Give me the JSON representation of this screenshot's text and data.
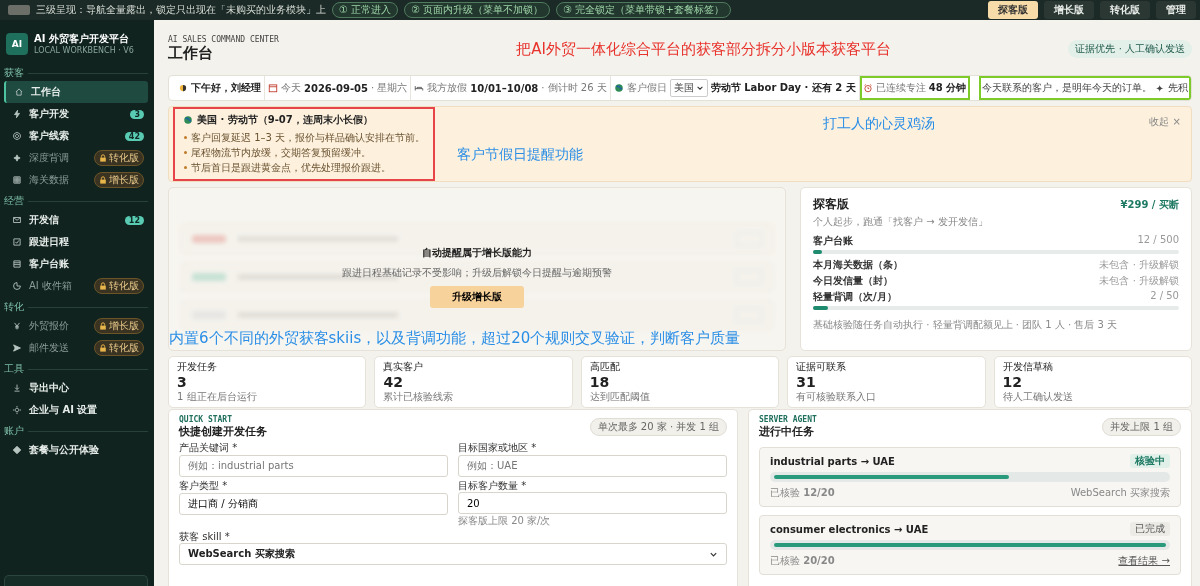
{
  "top_bar": {
    "caption": "三级呈现：导航全量露出，锁定只出现在「未购买的业务模块」上",
    "modes": [
      "① 正常进入",
      "② 页面内升级（菜单不加锁）",
      "③ 完全锁定（菜单带锁+套餐标签）"
    ],
    "plans": [
      {
        "label": "探客版",
        "selected": true
      },
      {
        "label": "增长版",
        "selected": false
      },
      {
        "label": "转化版",
        "selected": false
      },
      {
        "label": "管理",
        "selected": false
      }
    ]
  },
  "sidebar": {
    "logo": "AI",
    "title": "AI 外贸客户开发平台",
    "subtitle": "LOCAL WORKBENCH · V6",
    "sections": [
      {
        "label": "获客",
        "items": [
          {
            "label": "工作台",
            "selected": true,
            "kind": "plain"
          },
          {
            "label": "客户开发",
            "selected": false,
            "kind": "count",
            "badge": "3"
          },
          {
            "label": "客户线索",
            "selected": false,
            "kind": "count",
            "badge": "42"
          },
          {
            "label": "深度背调",
            "selected": false,
            "kind": "locked",
            "badge": "转化版"
          },
          {
            "label": "海关数据",
            "selected": false,
            "kind": "locked",
            "badge": "增长版"
          }
        ]
      },
      {
        "label": "经营",
        "items": [
          {
            "label": "开发信",
            "selected": false,
            "kind": "count",
            "badge": "12"
          },
          {
            "label": "跟进日程",
            "selected": false,
            "kind": "plain"
          },
          {
            "label": "客户台账",
            "selected": false,
            "kind": "plain"
          },
          {
            "label": "AI 收件箱",
            "selected": false,
            "kind": "locked",
            "badge": "转化版"
          }
        ]
      },
      {
        "label": "转化",
        "items": [
          {
            "label": "外贸报价",
            "selected": false,
            "kind": "locked",
            "badge": "增长版"
          },
          {
            "label": "邮件发送",
            "selected": false,
            "kind": "locked",
            "badge": "转化版"
          }
        ]
      },
      {
        "label": "工具",
        "items": [
          {
            "label": "导出中心",
            "selected": false,
            "kind": "plain"
          },
          {
            "label": "企业与 AI 设置",
            "selected": false,
            "kind": "plain"
          }
        ]
      },
      {
        "label": "账户",
        "items": [
          {
            "label": "套餐与公开体验",
            "selected": false,
            "kind": "plain"
          }
        ]
      }
    ]
  },
  "header": {
    "eyebrow": "AI SALES COMMAND CENTER",
    "title": "工作台",
    "note": "把AI外贸一体化综合平台的获客部分拆分小版本获客平台",
    "badge": "证据优先 · 人工确认发送"
  },
  "info_bar": {
    "greeting": "下午好，刘经理",
    "today_label": "今天",
    "today": "2026-09-05",
    "weekday": "· 星期六",
    "vacation_label": "我方放假",
    "vacation": "10/01–10/08",
    "countdown": "· 倒计时 26 天",
    "holiday_label": "客户假日",
    "country": "美国",
    "holiday": "劳动节 Labor Day · 还有 2 天",
    "focus": {
      "label": "已连续专注",
      "value": "48 分钟",
      "highlighted": true
    },
    "quote": {
      "text": "今天联系的客户，是明年今天的订单。",
      "mark": "✦",
      "next": "先积",
      "highlighted": true
    }
  },
  "holiday_banner": {
    "title": "美国 · 劳动节（9-07，连周末小长假）",
    "highlighted": true,
    "tips": [
      "客户回复延迟 1–3 天，报价与样品确认安排在节前。",
      "尾程物流节内放缓，交期答复预留缓冲。",
      "节后首日是跟进黄金点，优先处理报价跟进。"
    ],
    "notes": [
      "客户节假日提醒功能",
      "打工人的心灵鸡汤"
    ],
    "collapse": "收起 ×"
  },
  "locked_card": {
    "title": "自动提醒属于增长版能力",
    "text": "跟进日程基础记录不受影响；升级后解锁今日提醒与逾期预警",
    "button": "升级增长版",
    "note": "内置6个不同的外贸获客skiis，以及背调功能，超过20个规则交叉验证，判断客户质量"
  },
  "plan_card": {
    "title": "探客版",
    "price": "¥299 / 买断",
    "subtitle": "个人起步，跑通「找客户 → 发开发信」",
    "quotas": [
      {
        "kind": "meter",
        "label": "客户台账",
        "reading": "12 / 500",
        "level": 0.024
      },
      {
        "kind": "locked",
        "label": "本月海关数据（条）",
        "reading": "未包含 · 升级解锁"
      },
      {
        "kind": "locked",
        "label": "今日发信量（封）",
        "reading": "未包含 · 升级解锁"
      },
      {
        "kind": "meter",
        "label": "轻量背调（次/月）",
        "reading": "2 / 50",
        "level": 0.04
      }
    ],
    "footer": "基础核验随任务自动执行 · 轻量背调配额见上 · 团队 1 人 · 售后 3 天"
  },
  "stats": [
    {
      "label": "开发任务",
      "value": "3",
      "sub": "1 组正在后台运行"
    },
    {
      "label": "真实客户",
      "value": "42",
      "sub": "累计已核验线索"
    },
    {
      "label": "高匹配",
      "value": "18",
      "sub": "达到匹配阈值"
    },
    {
      "label": "证据可联系",
      "value": "31",
      "sub": "有可核验联系入口"
    },
    {
      "label": "开发信草稿",
      "value": "12",
      "sub": "待人工确认发送"
    }
  ],
  "quick_start": {
    "eyebrow": "QUICK START",
    "title": "快捷创建开发任务",
    "limit": "单次最多 20 家 · 并发 1 组",
    "fields": [
      {
        "kind": "input",
        "label": "产品关键词 *",
        "placeholder": "例如：industrial parts"
      },
      {
        "kind": "input",
        "label": "目标国家或地区 *",
        "placeholder": "例如：UAE"
      },
      {
        "kind": "input",
        "label": "客户类型 *",
        "value": "进口商 / 分销商"
      },
      {
        "kind": "input",
        "label": "目标客户数量 *",
        "value": "20",
        "hint": "探客版上限 20 家/次"
      },
      {
        "kind": "select",
        "label": "获客 skill *",
        "value": "WebSearch 买家搜索"
      }
    ]
  },
  "tasks_panel": {
    "eyebrow": "SERVER AGENT",
    "title": "进行中任务",
    "limit": "并发上限 1 组",
    "tasks": [
      {
        "title": "industrial parts → UAE",
        "status": "核验中",
        "done": false,
        "level": 0.6,
        "progress_label": "已核验",
        "progress": "12/20",
        "source": "WebSearch 买家搜索"
      },
      {
        "title": "consumer electronics → UAE",
        "status": "已完成",
        "done": true,
        "level": 1,
        "progress_label": "已核验",
        "progress": "20/20",
        "link": "查看结果 →"
      }
    ]
  }
}
